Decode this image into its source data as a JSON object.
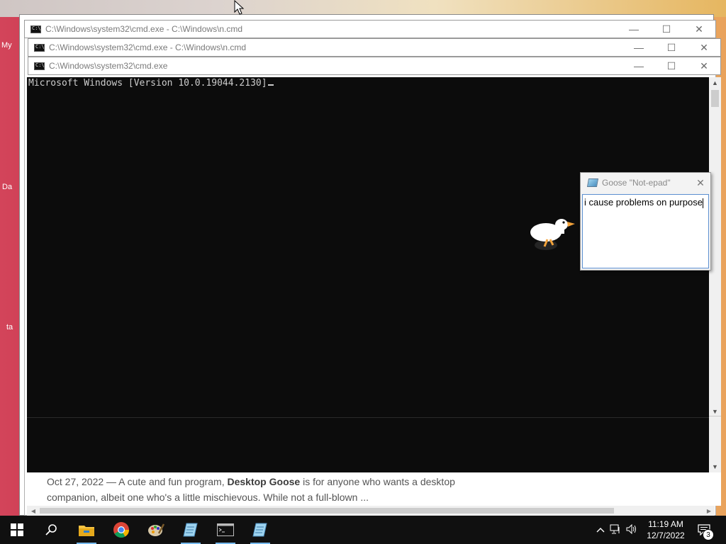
{
  "desktop": {
    "icon_labels": [
      "My",
      "Da",
      "ta"
    ]
  },
  "windows": [
    {
      "title": "C:\\Windows\\system32\\cmd.exe - C:\\Windows\\n.cmd",
      "controls": {
        "minimize": "—",
        "maximize": "☐",
        "close": "✕"
      }
    },
    {
      "title": "C:\\Windows\\system32\\cmd.exe - C:\\Windows\\n.cmd",
      "controls": {
        "minimize": "—",
        "maximize": "☐",
        "close": "✕"
      }
    },
    {
      "title": "C:\\Windows\\system32\\cmd.exe",
      "controls": {
        "minimize": "—",
        "maximize": "☐",
        "close": "✕"
      }
    }
  ],
  "console": {
    "output": "Microsoft Windows [Version 10.0.19044.2130]"
  },
  "notepad": {
    "title": "Goose \"Not-epad\"",
    "text": "i cause problems on purpose",
    "close": "✕"
  },
  "browser": {
    "snippet_date": "Oct 27, 2022 — A cute and fun program, ",
    "snippet_bold": "Desktop Goose",
    "snippet_rest": " is for anyone who wants a desktop companion, albeit one who's a little mischievous. While not a full-blown ..."
  },
  "taskbar": {
    "items": [
      "windows-start",
      "search",
      "file-explorer",
      "chrome",
      "paint",
      "notepad",
      "cmd",
      "notepad-2"
    ],
    "time": "11:19 AM",
    "date": "12/7/2022",
    "notification_count": "3"
  },
  "colors": {
    "console_bg": "#0c0c0c",
    "console_fg": "#cccccc",
    "taskbar_bg": "#101010",
    "accent": "#76b9ed"
  }
}
